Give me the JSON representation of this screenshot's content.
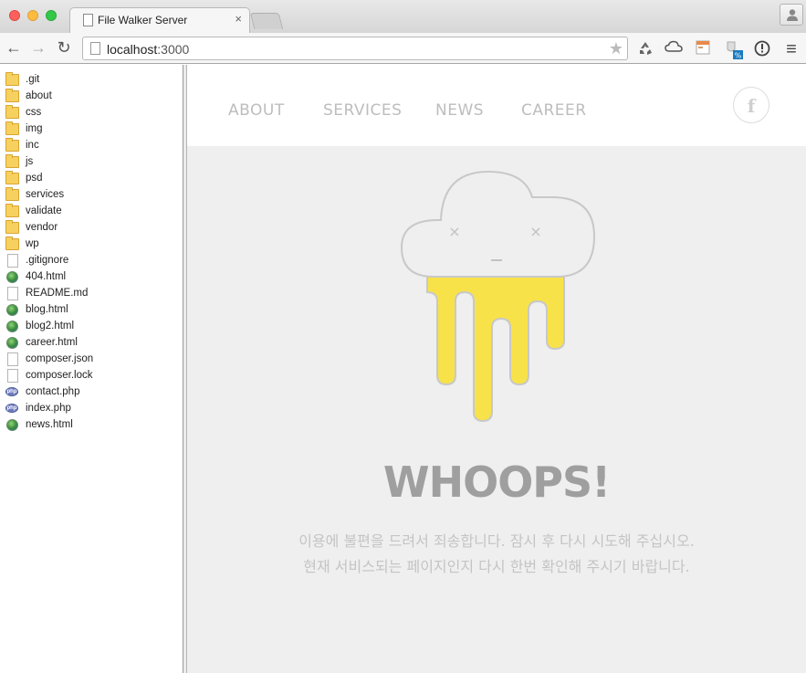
{
  "browser": {
    "tab_title": "File Walker Server",
    "tab_close": "×",
    "url_host": "localhost",
    "url_port": ":3000"
  },
  "toolbar": {
    "back_icon": "←",
    "forward_icon": "→",
    "reload_icon": "↻",
    "star_icon": "★",
    "menu_icon": "≡"
  },
  "sidebar": {
    "files": [
      {
        "name": ".git",
        "type": "folder"
      },
      {
        "name": "about",
        "type": "folder"
      },
      {
        "name": "css",
        "type": "folder"
      },
      {
        "name": "img",
        "type": "folder"
      },
      {
        "name": "inc",
        "type": "folder"
      },
      {
        "name": "js",
        "type": "folder"
      },
      {
        "name": "psd",
        "type": "folder"
      },
      {
        "name": "services",
        "type": "folder"
      },
      {
        "name": "validate",
        "type": "folder"
      },
      {
        "name": "vendor",
        "type": "folder"
      },
      {
        "name": "wp",
        "type": "folder"
      },
      {
        "name": ".gitignore",
        "type": "doc"
      },
      {
        "name": "404.html",
        "type": "web"
      },
      {
        "name": "README.md",
        "type": "doc"
      },
      {
        "name": "blog.html",
        "type": "web"
      },
      {
        "name": "blog2.html",
        "type": "web"
      },
      {
        "name": "career.html",
        "type": "web"
      },
      {
        "name": "composer.json",
        "type": "doc"
      },
      {
        "name": "composer.lock",
        "type": "doc"
      },
      {
        "name": "contact.php",
        "type": "php"
      },
      {
        "name": "index.php",
        "type": "php"
      },
      {
        "name": "news.html",
        "type": "web"
      }
    ]
  },
  "site": {
    "nav": [
      "ABOUT",
      "SERVICES",
      "NEWS",
      "CAREER"
    ],
    "facebook_icon": "f",
    "heading": "WHOOPS!",
    "message_line1": "이용에 불편을 드려서 죄송합니다. 잠시 후 다시 시도해 주십시오.",
    "message_line2": "현재 서비스되는 페이지인지 다시 한번 확인해 주시기 바랍니다.",
    "face_eyes": "×",
    "drip_color": "#f8e249",
    "cloud_stroke": "#c8c8c8"
  }
}
